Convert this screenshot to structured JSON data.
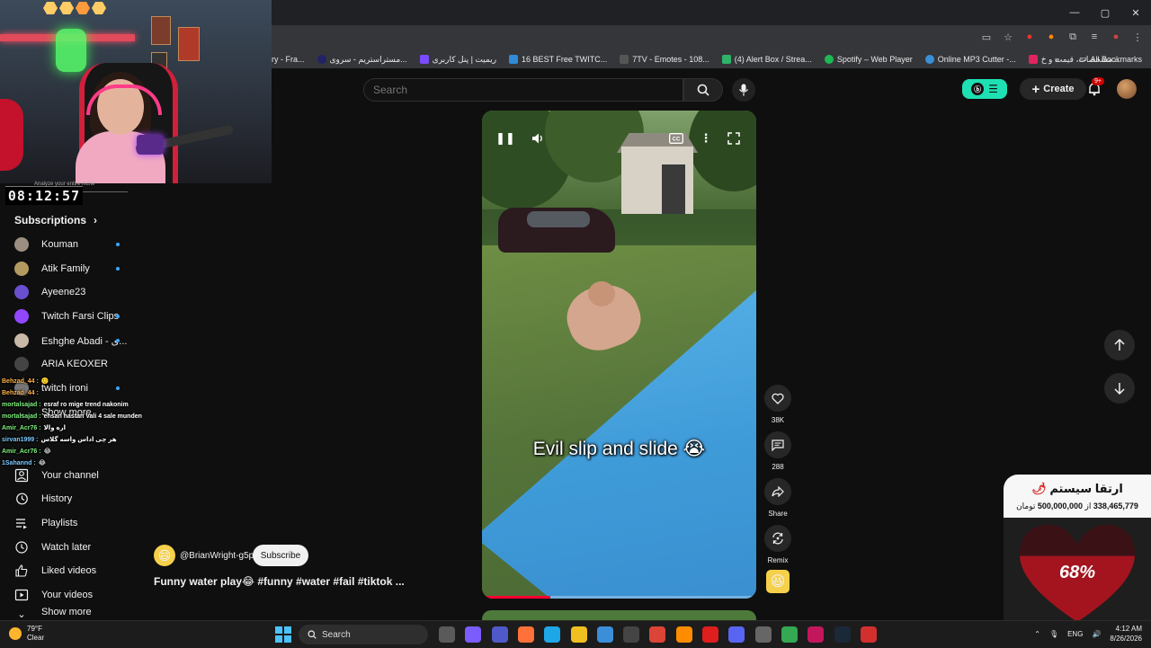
{
  "browser": {
    "window_controls": [
      "—",
      "▢",
      "✕"
    ],
    "bookmarks": [
      {
        "label": "ry - Fra...",
        "color": "#444444"
      },
      {
        "label": "مستراستریم - سروی...",
        "color": "#222266"
      },
      {
        "label": "ریمیت | پنل کاربری",
        "color": "#7a4cff"
      },
      {
        "label": "16 BEST Free TWITC...",
        "color": "#2f8bd8"
      },
      {
        "label": "7TV - Emotes - 108...",
        "color": "#333333"
      },
      {
        "label": "(4) Alert Box / Strea...",
        "color": "#2fb36a"
      },
      {
        "label": "Spotify – Web Player",
        "color": "#1db954"
      },
      {
        "label": "Online MP3 Cutter -...",
        "color": "#3a8fd8"
      },
      {
        "label": "مشخصات، قیمت و خ...",
        "color": "#e0245e"
      }
    ],
    "all_bookmarks": "All Bookmarks"
  },
  "header": {
    "search_placeholder": "Search",
    "create_label": "Create",
    "notification_count": "9+"
  },
  "stream": {
    "timer": "08:12:57",
    "timer_note": "Analyze your entire niche"
  },
  "sidebar": {
    "subscriptions_title": "Subscriptions",
    "subscriptions": [
      {
        "name": "Kouman",
        "color": "#9a8f80",
        "new": true
      },
      {
        "name": "Atik Family",
        "color": "#b39a60",
        "new": true
      },
      {
        "name": "Ayeene23",
        "color": "#6a4fd0",
        "new": false
      },
      {
        "name": "Twitch Farsi Clips",
        "color": "#9146ff",
        "new": true
      },
      {
        "name": "Eshghe Abadi - ی...",
        "color": "#c8b9a8",
        "new": true
      },
      {
        "name": "ARIA KEOXER",
        "color": "#444444",
        "new": false
      },
      {
        "name": "twitch ironi",
        "color": "#777777",
        "new": true
      }
    ],
    "show_more": "Show more",
    "you_items": [
      {
        "label": "Your channel",
        "icon": "person-icon"
      },
      {
        "label": "History",
        "icon": "history-icon"
      },
      {
        "label": "Playlists",
        "icon": "playlist-icon"
      },
      {
        "label": "Watch later",
        "icon": "clock-icon"
      },
      {
        "label": "Liked videos",
        "icon": "thumbs-up-icon"
      },
      {
        "label": "Your videos",
        "icon": "video-icon"
      }
    ],
    "show_more_2": "Show more"
  },
  "chat": [
    {
      "user": "Behzad_44 :",
      "msg": "🙂",
      "color": "orange"
    },
    {
      "user": "Behzad_44 :",
      "msg": "",
      "color": "orange"
    },
    {
      "user": "mortalsajad :",
      "msg": "esraf ro mige trend nakonim",
      "color": "green"
    },
    {
      "user": "mortalsajad :",
      "msg": "ehsan hastan Vali 4 sale munden",
      "color": "green"
    },
    {
      "user": "Amir_Acr76 :",
      "msg": "اره والا",
      "color": "green"
    },
    {
      "user": "sirvan1999 :",
      "msg": "هر چی اداس واسه گلاس",
      "color": "blue"
    },
    {
      "user": "Amir_Acr76 :",
      "msg": "😂",
      "color": "green"
    },
    {
      "user": "1Sahannd :",
      "msg": "😂",
      "color": "blue"
    }
  ],
  "video": {
    "caption": "Evil slip and slide 😭",
    "progress": 0.25,
    "channel": "@BrianWright-g5p",
    "subscribe_label": "Subscribe",
    "title": "Funny water play😂 #funny #water #fail #tiktok ...",
    "likes": "38K",
    "comments": "288",
    "share_label": "Share",
    "remix_label": "Remix"
  },
  "donation": {
    "title": "ارتقا سیستم",
    "current": "338,465,779",
    "separator": "از",
    "goal": "500,000,000",
    "unit": "تومان",
    "percent_label": "68%",
    "percent": 0.68,
    "heart_color": "#a3141f"
  },
  "taskbar": {
    "weather_temp": "79°F",
    "weather_desc": "Clear",
    "search_label": "Search",
    "lang": "ENG",
    "time": "4:12 AM",
    "date": "8/26/2026",
    "apps": [
      {
        "color": "#5a5a5a"
      },
      {
        "color": "#7a5cff"
      },
      {
        "color": "#5059c9"
      },
      {
        "color": "#ff7139"
      },
      {
        "color": "#1ea7e8"
      },
      {
        "color": "#f0c020"
      },
      {
        "color": "#3a8fd8"
      },
      {
        "color": "#444444"
      },
      {
        "color": "#db4437"
      },
      {
        "color": "#ff8c00"
      },
      {
        "color": "#e01e1e"
      },
      {
        "color": "#5865f2"
      },
      {
        "color": "#666666"
      },
      {
        "color": "#34a853"
      },
      {
        "color": "#c2185b"
      },
      {
        "color": "#1b2838"
      },
      {
        "color": "#d32f2f"
      }
    ]
  }
}
